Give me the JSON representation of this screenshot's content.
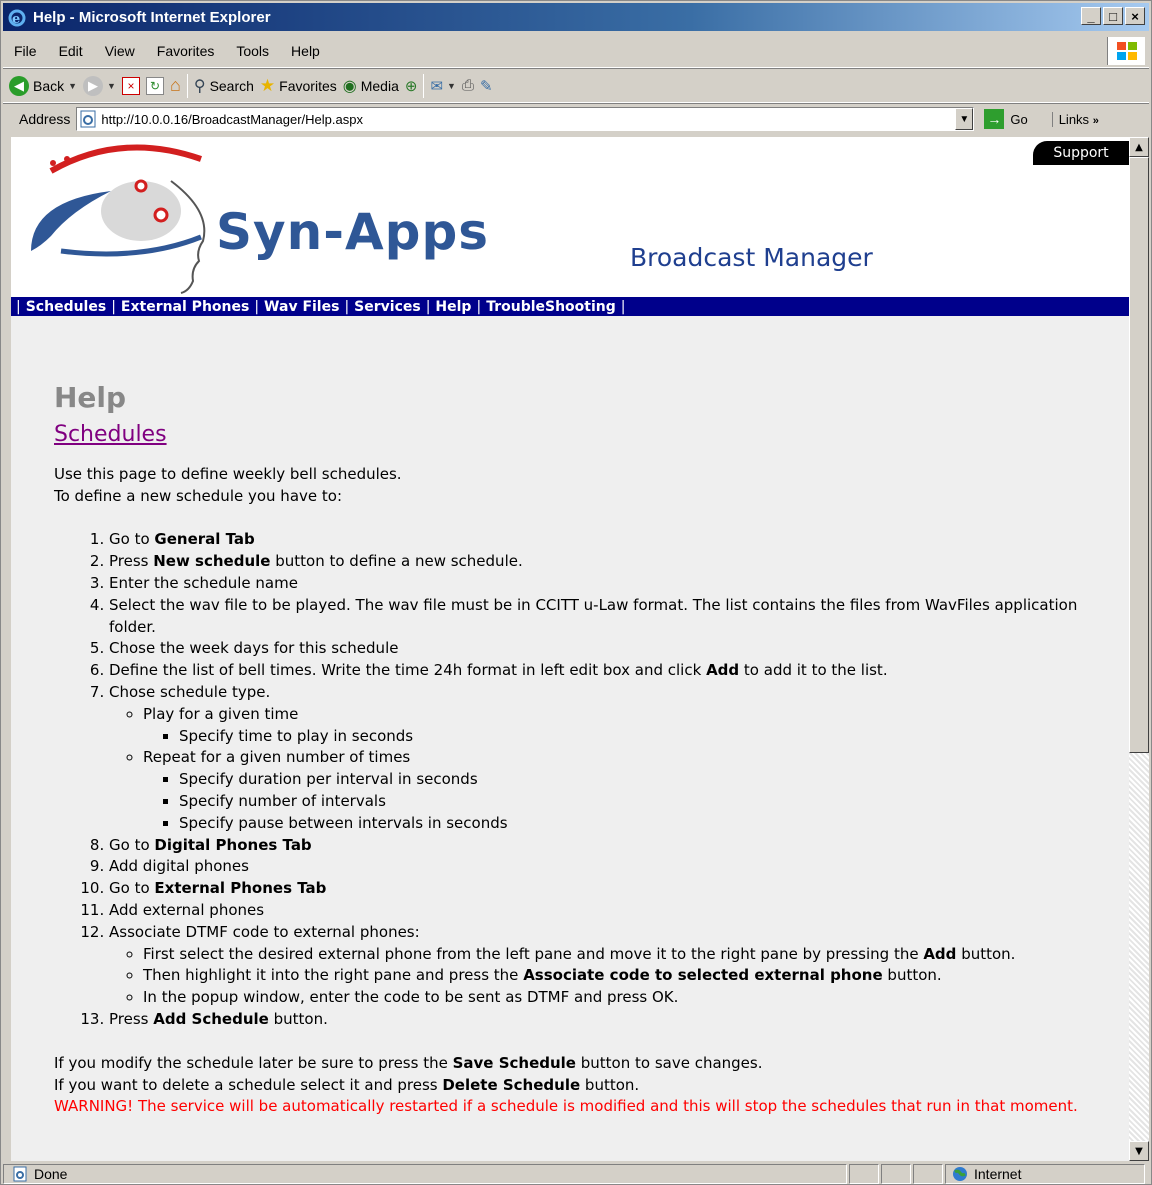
{
  "window": {
    "title": "Help - Microsoft Internet Explorer",
    "buttons": [
      "_",
      "□",
      "×"
    ]
  },
  "menu": [
    "File",
    "Edit",
    "View",
    "Favorites",
    "Tools",
    "Help"
  ],
  "toolbar": {
    "back": "Back",
    "search": "Search",
    "favorites": "Favorites",
    "media": "Media"
  },
  "address": {
    "label": "Address",
    "url": "http://10.0.0.16/BroadcastManager/Help.aspx",
    "go": "Go",
    "links": "Links"
  },
  "header": {
    "support": "Support",
    "brand": "Syn-Apps",
    "product": "Broadcast Manager"
  },
  "nav": [
    "Schedules",
    "External Phones",
    "Wav Files",
    "Services",
    "Help",
    "TroubleShooting"
  ],
  "content": {
    "title": "Help",
    "section": "Schedules",
    "intro1": "Use this page to define weekly bell schedules.",
    "intro2": "To define a new schedule you have to:",
    "steps": {
      "s1": {
        "pre": "Go to ",
        "b": "General Tab"
      },
      "s2": {
        "pre": "Press ",
        "b": "New schedule",
        "post": " button to define a new schedule."
      },
      "s3": "Enter the schedule name",
      "s4": "Select the wav file to be played. The wav file must be in CCITT u-Law format. The list contains the files from WavFiles application folder.",
      "s5": "Chose the week days for this schedule",
      "s6": {
        "pre": "Define the list of bell times. Write the time 24h format in left edit box and click ",
        "b": "Add",
        "post": " to add it to the list."
      },
      "s7": "Chose schedule type.",
      "s7a": "Play for a given time",
      "s7a1": "Specify time to play in seconds",
      "s7b": "Repeat for a given number of times",
      "s7b1": "Specify duration per interval in seconds",
      "s7b2": "Specify number of intervals",
      "s7b3": "Specify pause between intervals in seconds",
      "s8": {
        "pre": "Go to ",
        "b": "Digital Phones Tab"
      },
      "s9": "Add digital phones",
      "s10": {
        "pre": "Go to ",
        "b": "External Phones Tab"
      },
      "s11": "Add external phones",
      "s12": "Associate DTMF code to external phones:",
      "s12a": {
        "pre": "First select the desired external phone from the left pane and move it to the right pane by pressing the ",
        "b": "Add",
        "post": " button."
      },
      "s12b": {
        "pre": "Then highlight it into the right pane and press the ",
        "b": "Associate code to selected external phone",
        "post": " button."
      },
      "s12c": "In the popup window, enter the code to be sent as DTMF and press OK.",
      "s13": {
        "pre": "Press ",
        "b": "Add Schedule",
        "post": " button."
      }
    },
    "outro1": {
      "pre": "If you modify the schedule later be sure to press the ",
      "b": "Save Schedule",
      "post": " button to save changes."
    },
    "outro2": {
      "pre": "If you want to delete a schedule select it and press ",
      "b": "Delete Schedule",
      "post": " button."
    },
    "warning": "WARNING! The service will be automatically restarted if a schedule is modified and this will stop the schedules that run in that moment."
  },
  "status": {
    "text": "Done",
    "zone": "Internet"
  },
  "colors": {
    "nav_bg": "#00008b",
    "brand": "#2f5796",
    "link_visited": "#800080",
    "warning": "#ff0000"
  }
}
